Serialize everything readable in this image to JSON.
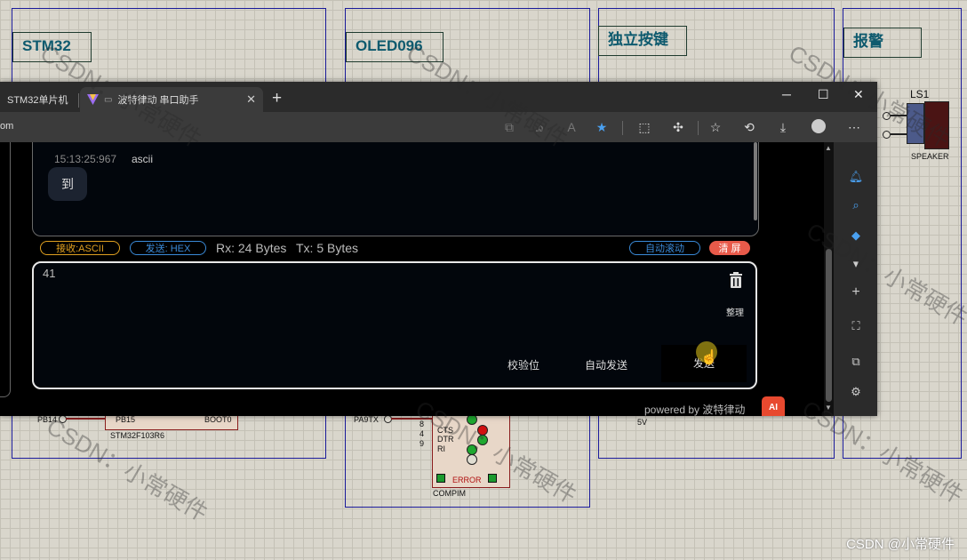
{
  "schematic": {
    "blocks": [
      {
        "title": "STM32"
      },
      {
        "title": "OLED096"
      },
      {
        "title": "独立按键"
      },
      {
        "title": "报警"
      }
    ],
    "labels": {
      "ls1": "LS1",
      "speaker": "SPEAKER",
      "pb14": "PB14",
      "pb15": "PB15",
      "boot": "BOOT0",
      "chip": "STM32F103R6",
      "pa9": "PA9TX",
      "cts": "CTS",
      "dtr": "DTR",
      "ri": "RI",
      "n8": "8",
      "n4": "4",
      "n9": "9",
      "error": "ERROR",
      "compim": "COMPIM",
      "fivev": "5V"
    },
    "watermark": "CSDN：小常硬件",
    "footer": "CSDN @小常硬件"
  },
  "browser": {
    "tabs": [
      {
        "label": "STM32单片机"
      },
      {
        "label": "波特律动 串口助手"
      }
    ],
    "url": "om",
    "window_controls": {
      "minimize": "─",
      "maximize": "☐",
      "close": "✕"
    }
  },
  "app": {
    "log": {
      "time": "15:13:25:967",
      "encoding": "ascii",
      "message": "到"
    },
    "controls": {
      "recv_mode": "接收:ASCII",
      "send_mode": "发送: HEX",
      "rx": "Rx: 24 Bytes",
      "tx": "Tx: 5 Bytes",
      "auto_scroll": "自动滚动",
      "clear": "清 屏"
    },
    "input": {
      "value": "41",
      "tidy_label": "整理",
      "checksum_label": "校验位",
      "auto_send_label": "自动发送",
      "send_label": "发送"
    },
    "powered_by": "powered by 波特律动",
    "logo_text": "AI"
  },
  "colors": {
    "recv_badge": "#e0a020",
    "send_badge": "#3a8ad8",
    "clear_button": "#e85a4a",
    "schematic_frame": "#1a1a9a",
    "schematic_title": "#0e5a6e"
  }
}
